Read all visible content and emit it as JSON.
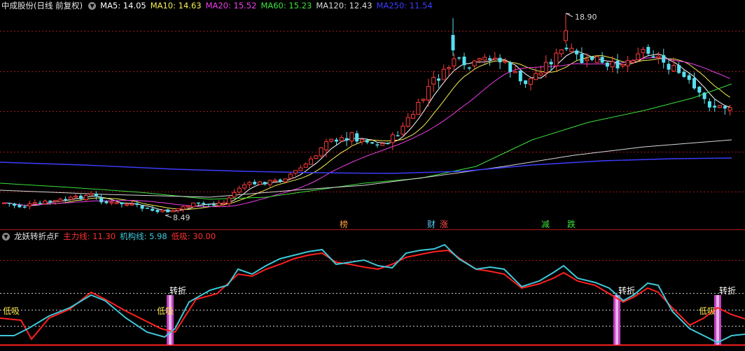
{
  "main_header": {
    "title": "中成股份(日线 前复权)",
    "mas": [
      {
        "label": "MA5: 14.05",
        "color": "#ffffff"
      },
      {
        "label": "MA10: 14.63",
        "color": "#f5f051"
      },
      {
        "label": "MA20: 15.52",
        "color": "#ee3ee8"
      },
      {
        "label": "MA60: 15.23",
        "color": "#3ae23a"
      },
      {
        "label": "MA120: 12.43",
        "color": "#d8d8d8"
      },
      {
        "label": "MA250: 11.54",
        "color": "#3d3dff"
      }
    ]
  },
  "price_annotations": {
    "high": "18.90",
    "low": "8.49"
  },
  "event_tags": [
    {
      "text": "榜",
      "color": "#ff9a3c"
    },
    {
      "text": "财",
      "color": "#59c9ff"
    },
    {
      "text": "涨",
      "color": "#ff4a4a"
    },
    {
      "text": "减",
      "color": "#3ae23a"
    },
    {
      "text": "跌",
      "color": "#3ae23a"
    }
  ],
  "indicator_header": {
    "name": "龙妖转折点F",
    "main_line": "主力线: 11.30",
    "inst_line": "机构线: 5.98",
    "low_buy": "低吸: 30.00"
  },
  "indicator_labels": {
    "turn": "转折",
    "dip": "低吸"
  },
  "colors": {
    "up": "#ff3b3b",
    "down": "#56e0f0",
    "main_line": "#ff2020",
    "inst_line": "#3ec8d8",
    "grid": "#a01818",
    "signal_bar": "#ff40ff"
  }
}
